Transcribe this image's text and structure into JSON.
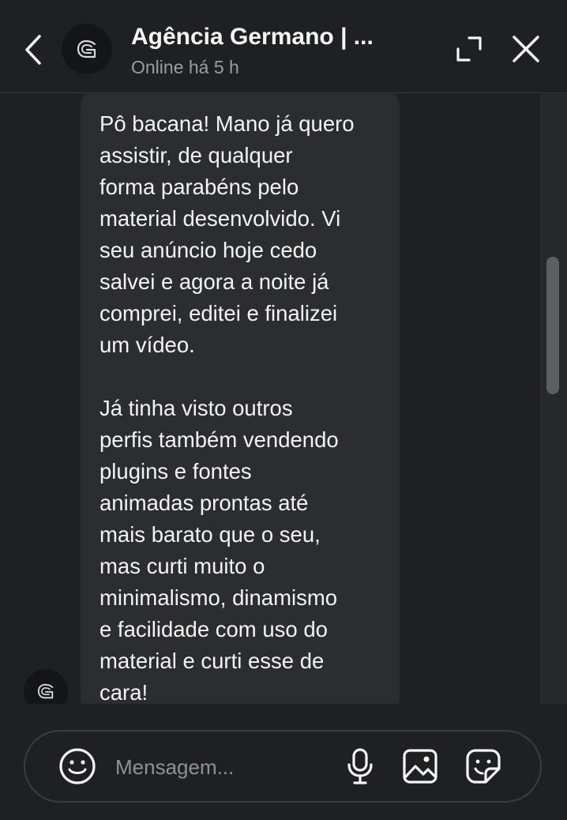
{
  "header": {
    "title": "Agência Germano | ...",
    "status": "Online há 5 h"
  },
  "message": {
    "paragraphs": [
      "Pô bacana! Mano já quero\nassistir, de qualquer\nforma parabéns pelo\nmaterial desenvolvido. Vi\nseu anúncio hoje cedo\nsalvei e agora a noite já\ncomprei, editei e finalizei\num vídeo.",
      "Já tinha visto outros\nperfis também vendendo\nplugins e fontes\nanimadas prontas até\nmais barato que o seu,\nmas curti muito o\nminimalismo, dinamismo\ne facilidade com uso do\nmaterial e curti esse de\ncara!"
    ]
  },
  "composer": {
    "placeholder": "Mensagem..."
  },
  "icons": {
    "back": "chevron-left-icon",
    "minimize": "minimize-icon",
    "close": "close-icon",
    "emoji": "emoji-icon",
    "mic": "microphone-icon",
    "image": "image-icon",
    "sticker": "sticker-icon",
    "avatar_logo": "g-logo-icon"
  },
  "colors": {
    "background": "#1e2024",
    "bubble": "#2b2d31",
    "text": "#f5f5f5",
    "muted": "#9a9ca1"
  }
}
